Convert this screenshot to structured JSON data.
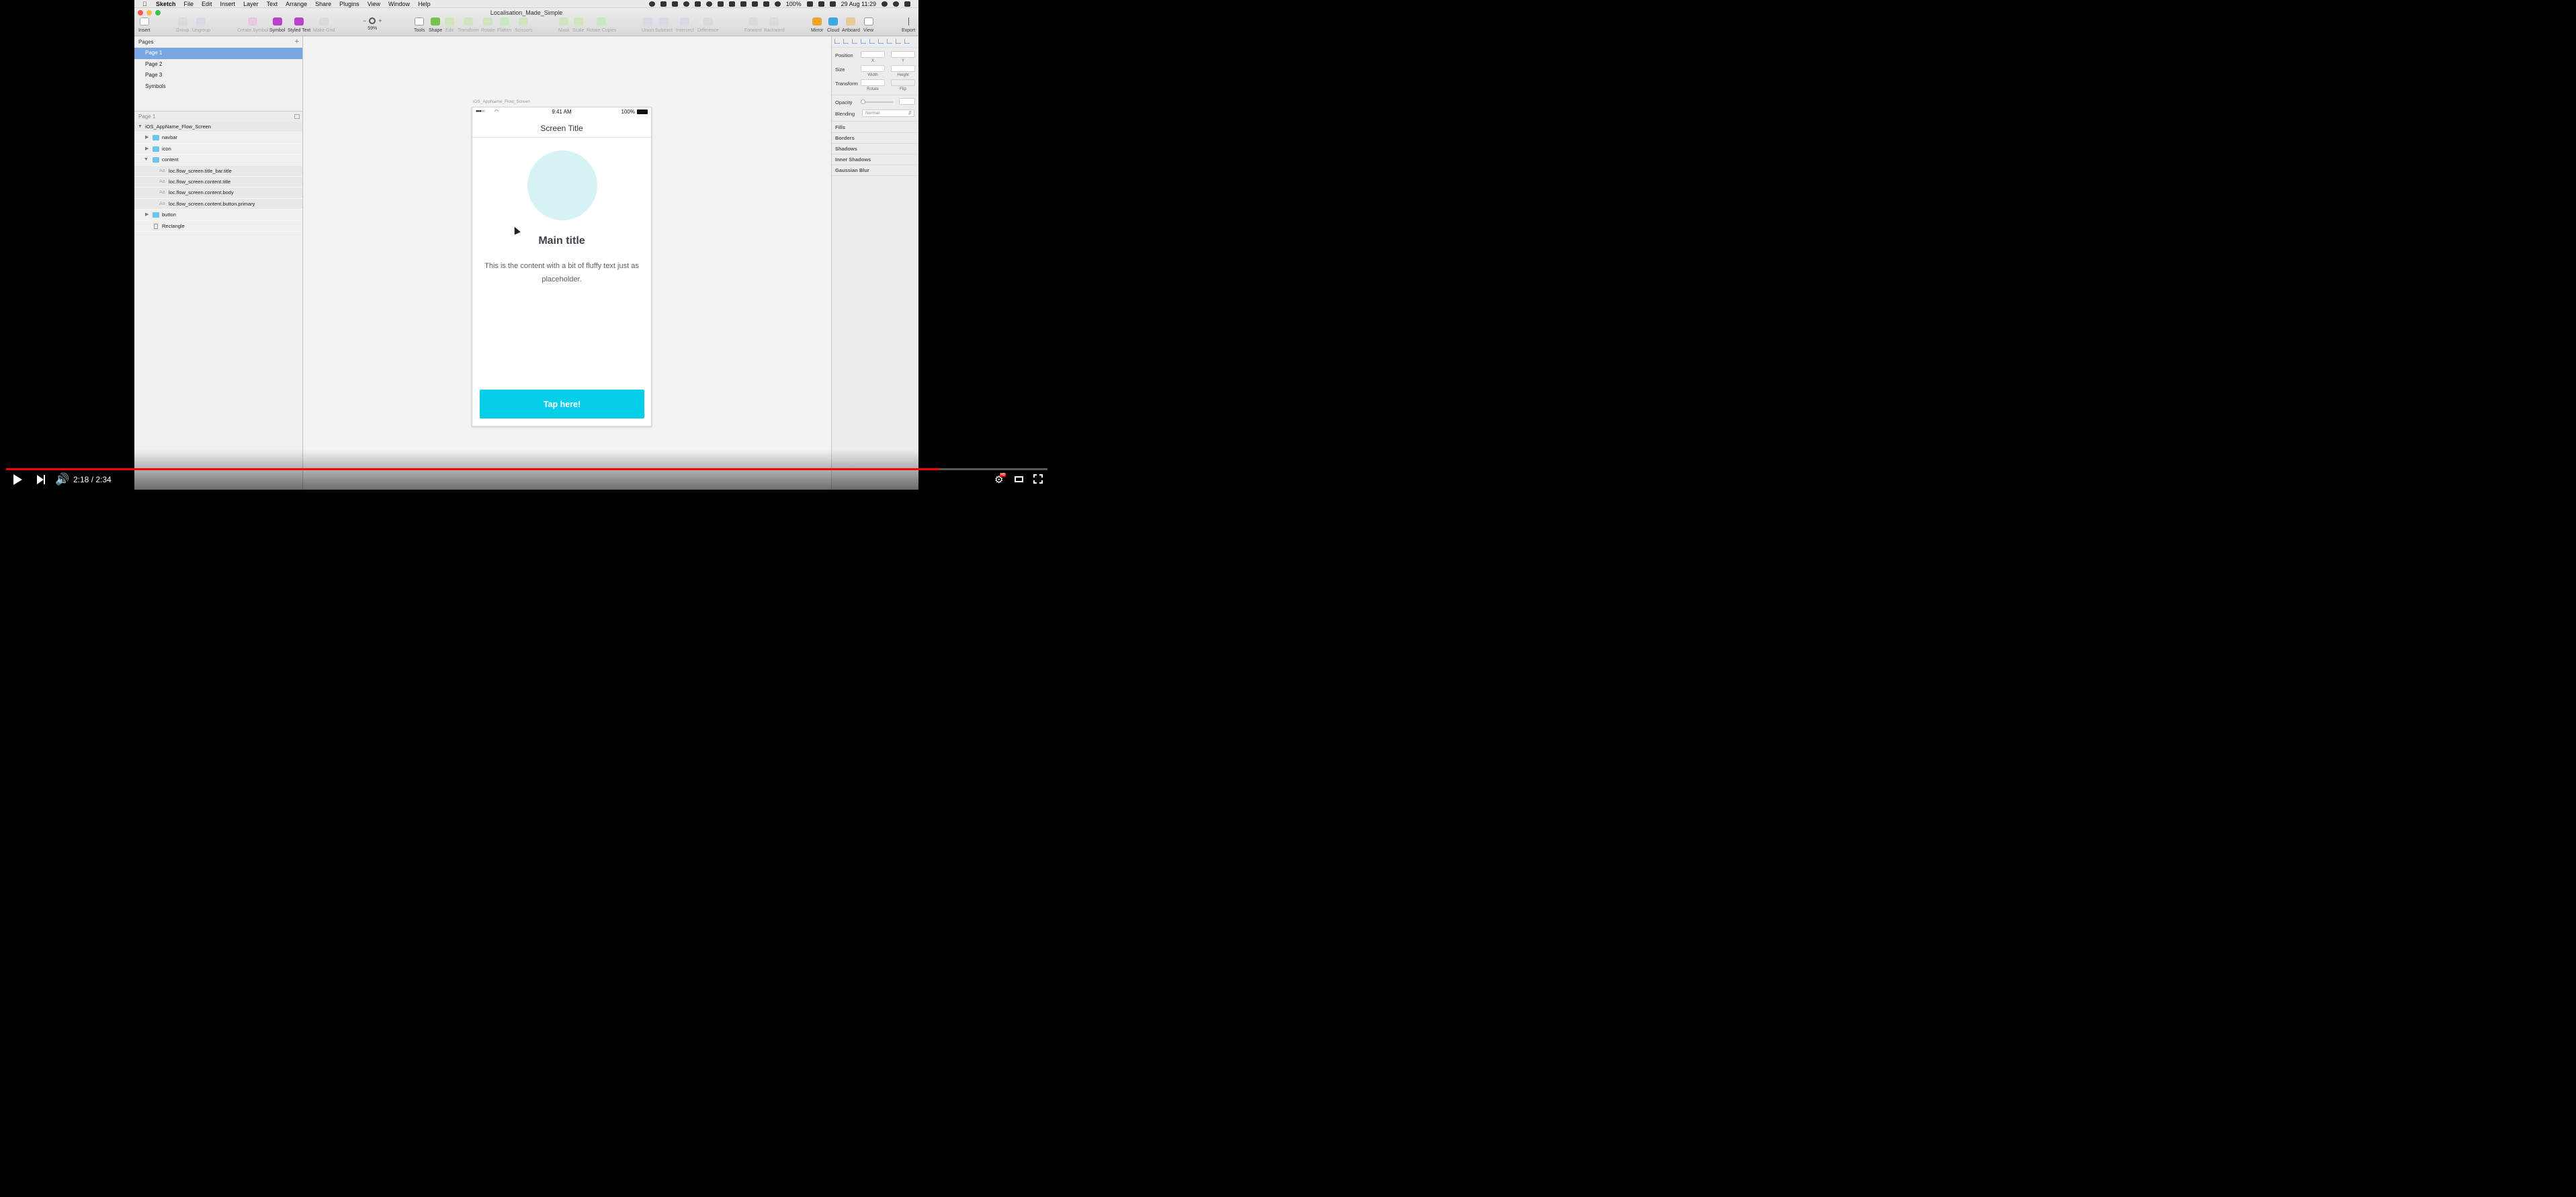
{
  "menubar": {
    "app_name": "Sketch",
    "items": [
      "File",
      "Edit",
      "Insert",
      "Layer",
      "Text",
      "Arrange",
      "Share",
      "Plugins",
      "View",
      "Window",
      "Help"
    ],
    "battery": "100%",
    "datetime": "29 Aug  11:29"
  },
  "window": {
    "title": "Localisation_Made_Simple"
  },
  "toolbar": {
    "insert": "Insert",
    "group": "Group",
    "ungroup": "Ungroup",
    "create_symbol": "Create Symbol",
    "symbol": "Symbol",
    "styled_text": "Styled Text",
    "make_grid": "Make Grid",
    "zoom_value": "59%",
    "zoom_minus": "−",
    "zoom_plus": "+",
    "tools": "Tools",
    "shape": "Shape",
    "edit": "Edit",
    "transform": "Transform",
    "rotate": "Rotate",
    "flatten": "Flatten",
    "scissors": "Scissors",
    "mask": "Mask",
    "scale": "Scale",
    "rotate_copies": "Rotate Copies",
    "union": "Union",
    "subtract": "Subtract",
    "intersect": "Intersect",
    "difference": "Difference",
    "forward": "Forward",
    "backward": "Backward",
    "mirror": "Mirror",
    "cloud": "Cloud",
    "artboard": "Artboard",
    "view": "View",
    "export": "Export"
  },
  "pages_panel": {
    "header": "Pages",
    "add": "+",
    "pages": [
      "Page 1",
      "Page 2",
      "Page 3",
      "Symbols"
    ]
  },
  "layers_panel": {
    "header": "Page 1",
    "artboard": "iOS_AppName_Flow_Screen",
    "layers": {
      "navbar": "navbar",
      "icon": "icon",
      "content": "content",
      "t1": "loc.flow_screen.title_bar.title",
      "t2": "loc.flow_screen.content.title",
      "t3": "loc.flow_screen.content.body",
      "t4": "loc.flow_screen.content.button.primary",
      "button": "button",
      "rectangle": "Rectangle"
    },
    "text_icon": "Aa"
  },
  "artboard": {
    "label": "iOS_AppName_Flow_Screen",
    "status_time": "9:41 AM",
    "status_battery": "100%",
    "screen_title": "Screen Title",
    "main_title": "Main title",
    "body": "This is the content with a bit of fluffy text just as placeholder.",
    "button": "Tap here!"
  },
  "inspector": {
    "position": "Position",
    "x": "X",
    "y": "Y",
    "size": "Size",
    "width": "Width",
    "height": "Height",
    "transform": "Transform",
    "rotate": "Rotate",
    "flip": "Flip",
    "opacity": "Opacity",
    "blending": "Blending",
    "blending_value": "Normal",
    "fills": "Fills",
    "borders": "Borders",
    "shadows": "Shadows",
    "inner_shadows": "Inner Shadows",
    "gaussian_blur": "Gaussian Blur"
  },
  "video": {
    "time": "2:18 / 2:34",
    "progress": 0.896,
    "hd_badge": "HD"
  },
  "colors": {
    "accent_selection": "#7aa7e3",
    "button": "#05cfe8",
    "hero_circle": "#d7f3f6",
    "progress": "#ff0000"
  }
}
